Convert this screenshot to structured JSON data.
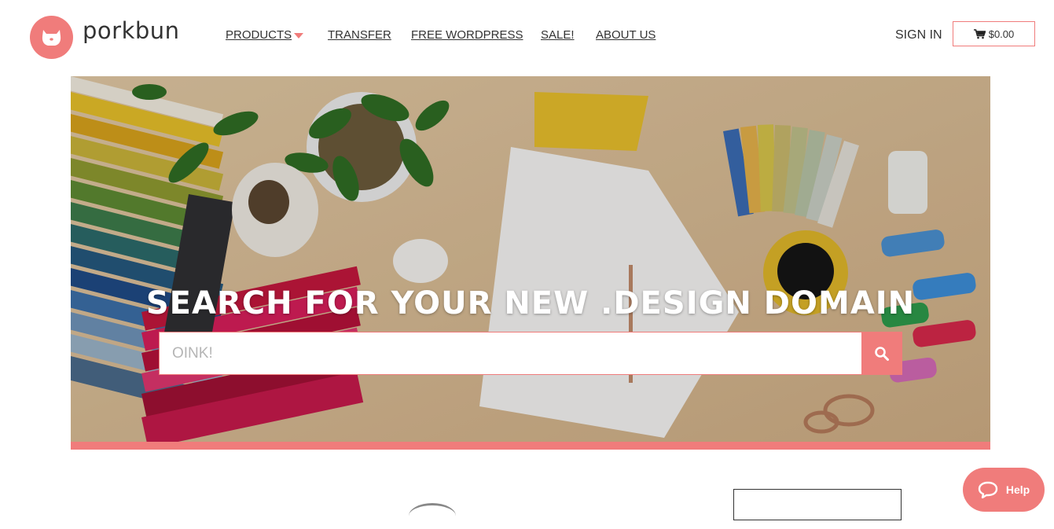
{
  "brand": {
    "name": "porkbun",
    "accent_color": "#f07c7b"
  },
  "nav": {
    "items": [
      {
        "label": "PRODUCTS",
        "has_dropdown": true
      },
      {
        "label": "TRANSFER"
      },
      {
        "label": "FREE WORDPRESS"
      },
      {
        "label": "SALE!"
      },
      {
        "label": "ABOUT US"
      }
    ]
  },
  "account": {
    "signin_label": "SIGN IN",
    "cart_total": "$0.00",
    "cart_icon": "shopping-cart-icon"
  },
  "hero": {
    "headline": "SEARCH FOR YOUR NEW .DESIGN DOMAIN",
    "search_placeholder": "OINK!",
    "search_icon": "search-icon"
  },
  "help": {
    "label": "Help",
    "icon": "chat-bubble-icon"
  }
}
